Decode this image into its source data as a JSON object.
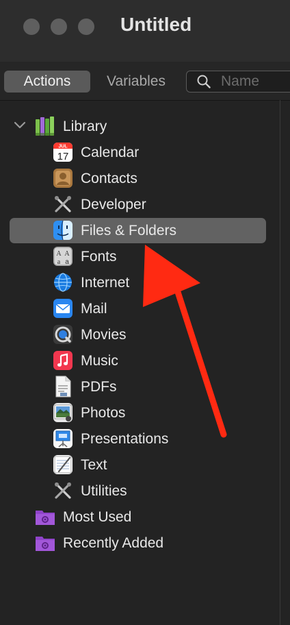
{
  "window": {
    "title": "Untitled"
  },
  "toolbar": {
    "tab_actions": "Actions",
    "tab_variables": "Variables",
    "search_placeholder": "Name"
  },
  "library": {
    "label": "Library",
    "items": [
      {
        "label": "Calendar",
        "icon": "calendar-icon"
      },
      {
        "label": "Contacts",
        "icon": "contacts-icon"
      },
      {
        "label": "Developer",
        "icon": "developer-tools-icon"
      },
      {
        "label": "Files & Folders",
        "icon": "finder-icon",
        "selected": true
      },
      {
        "label": "Fonts",
        "icon": "fonts-icon"
      },
      {
        "label": "Internet",
        "icon": "globe-icon"
      },
      {
        "label": "Mail",
        "icon": "mail-icon"
      },
      {
        "label": "Movies",
        "icon": "quicktime-icon"
      },
      {
        "label": "Music",
        "icon": "music-icon"
      },
      {
        "label": "PDFs",
        "icon": "pdf-icon"
      },
      {
        "label": "Photos",
        "icon": "photos-icon"
      },
      {
        "label": "Presentations",
        "icon": "presentation-icon"
      },
      {
        "label": "Text",
        "icon": "text-icon"
      },
      {
        "label": "Utilities",
        "icon": "utilities-icon"
      }
    ]
  },
  "smart_groups": [
    {
      "label": "Most Used",
      "icon": "smart-folder-icon"
    },
    {
      "label": "Recently Added",
      "icon": "smart-folder-icon"
    }
  ],
  "calendar_icon_month": "JUL",
  "calendar_icon_day": "17",
  "colors": {
    "selection": "#626262",
    "annotation_arrow": "#ff2a12"
  }
}
